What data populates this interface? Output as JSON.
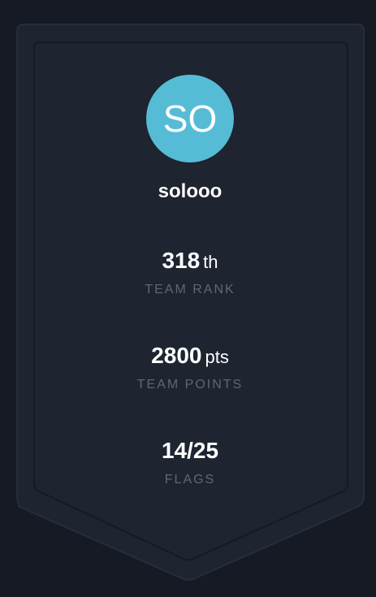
{
  "colors": {
    "page_background": "#151a24",
    "banner_fill": "#1e2430",
    "banner_border": "#2a303c",
    "avatar_background": "#56bcd6",
    "label_color": "#5f6777"
  },
  "profile": {
    "initials": "SO",
    "username": "solooo"
  },
  "stats": {
    "rank": {
      "value": "318",
      "unit": "th",
      "label": "TEAM RANK"
    },
    "points": {
      "value": "2800",
      "unit": "pts",
      "label": "TEAM POINTS"
    },
    "flags": {
      "value": "14/25",
      "label": "FLAGS"
    }
  }
}
